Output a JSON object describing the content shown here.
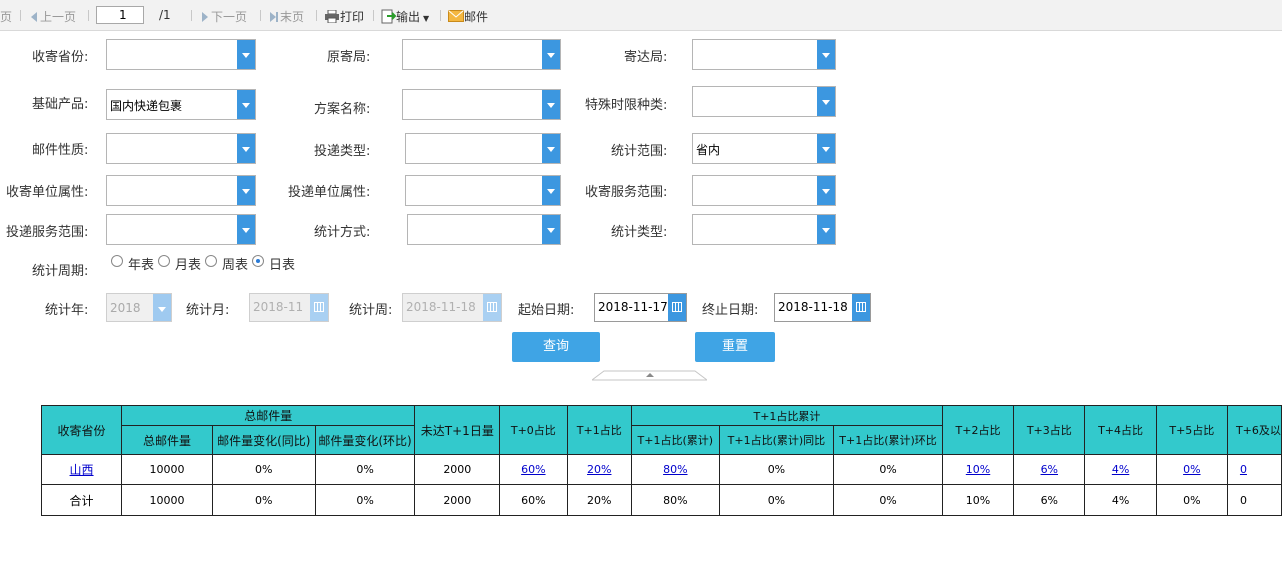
{
  "toolbar": {
    "first_page": "页",
    "prev_page": "上一页",
    "page_number": "1",
    "page_total": "/1",
    "next_page": "下一页",
    "last_page": "末页",
    "print": "打印",
    "export": "输出",
    "mail": "邮件"
  },
  "filters": {
    "collect_province": {
      "label": "收寄省份:",
      "value": ""
    },
    "origin_office": {
      "label": "原寄局:",
      "value": ""
    },
    "dest_office": {
      "label": "寄达局:",
      "value": ""
    },
    "base_product": {
      "label": "基础产品:",
      "value": "国内快递包裹"
    },
    "plan_name": {
      "label": "方案名称:",
      "value": ""
    },
    "special_limit": {
      "label": "特殊时限种类:",
      "value": ""
    },
    "mail_nature": {
      "label": "邮件性质:",
      "value": ""
    },
    "delivery_type": {
      "label": "投递类型:",
      "value": ""
    },
    "stat_scope": {
      "label": "统计范围:",
      "value": "省内"
    },
    "collect_unit_attr": {
      "label": "收寄单位属性:",
      "value": ""
    },
    "delivery_unit_attr": {
      "label": "投递单位属性:",
      "value": ""
    },
    "collect_service_scope": {
      "label": "收寄服务范围:",
      "value": ""
    },
    "delivery_service_scope": {
      "label": "投递服务范围:",
      "value": ""
    },
    "stat_method": {
      "label": "统计方式:",
      "value": ""
    },
    "stat_type": {
      "label": "统计类型:",
      "value": ""
    }
  },
  "period": {
    "label": "统计周期:",
    "options": [
      "年表",
      "月表",
      "周表",
      "日表"
    ],
    "selected": "日表"
  },
  "dates": {
    "year": {
      "label": "统计年:",
      "value": "2018"
    },
    "month": {
      "label": "统计月:",
      "value": "2018-11"
    },
    "week": {
      "label": "统计周:",
      "value": "2018-11-18"
    },
    "start": {
      "label": "起始日期:",
      "value": "2018-11-17"
    },
    "end": {
      "label": "终止日期:",
      "value": "2018-11-18"
    }
  },
  "buttons": {
    "query": "查询",
    "reset": "重置"
  },
  "table": {
    "header_top": {
      "province": "收寄省份",
      "total_group": "总邮件量",
      "not_reached": "未达T+1日量",
      "t0": "T+0占比",
      "t1": "T+1占比",
      "t1_cum_group": "T+1占比累计",
      "t2": "T+2占比",
      "t3": "T+3占比",
      "t4": "T+4占比",
      "t5": "T+5占比",
      "t6": "T+6及以"
    },
    "header_sub": {
      "total": "总邮件量",
      "yoy": "邮件量变化(同比)",
      "mom": "邮件量变化(环比)",
      "cum": "T+1占比(累计)",
      "cum_yoy": "T+1占比(累计)同比",
      "cum_mom": "T+1占比(累计)环比"
    },
    "rows": [
      {
        "province": "山西",
        "total": "10000",
        "yoy": "0%",
        "mom": "0%",
        "not_reached": "2000",
        "t0": "60%",
        "t1": "20%",
        "cum": "80%",
        "cum_yoy": "0%",
        "cum_mom": "0%",
        "t2": "10%",
        "t3": "6%",
        "t4": "4%",
        "t5": "0%",
        "t6": "0"
      },
      {
        "province": "合计",
        "total": "10000",
        "yoy": "0%",
        "mom": "0%",
        "not_reached": "2000",
        "t0": "60%",
        "t1": "20%",
        "cum": "80%",
        "cum_yoy": "0%",
        "cum_mom": "0%",
        "t2": "10%",
        "t3": "6%",
        "t4": "4%",
        "t5": "0%",
        "t6": "0"
      }
    ]
  }
}
